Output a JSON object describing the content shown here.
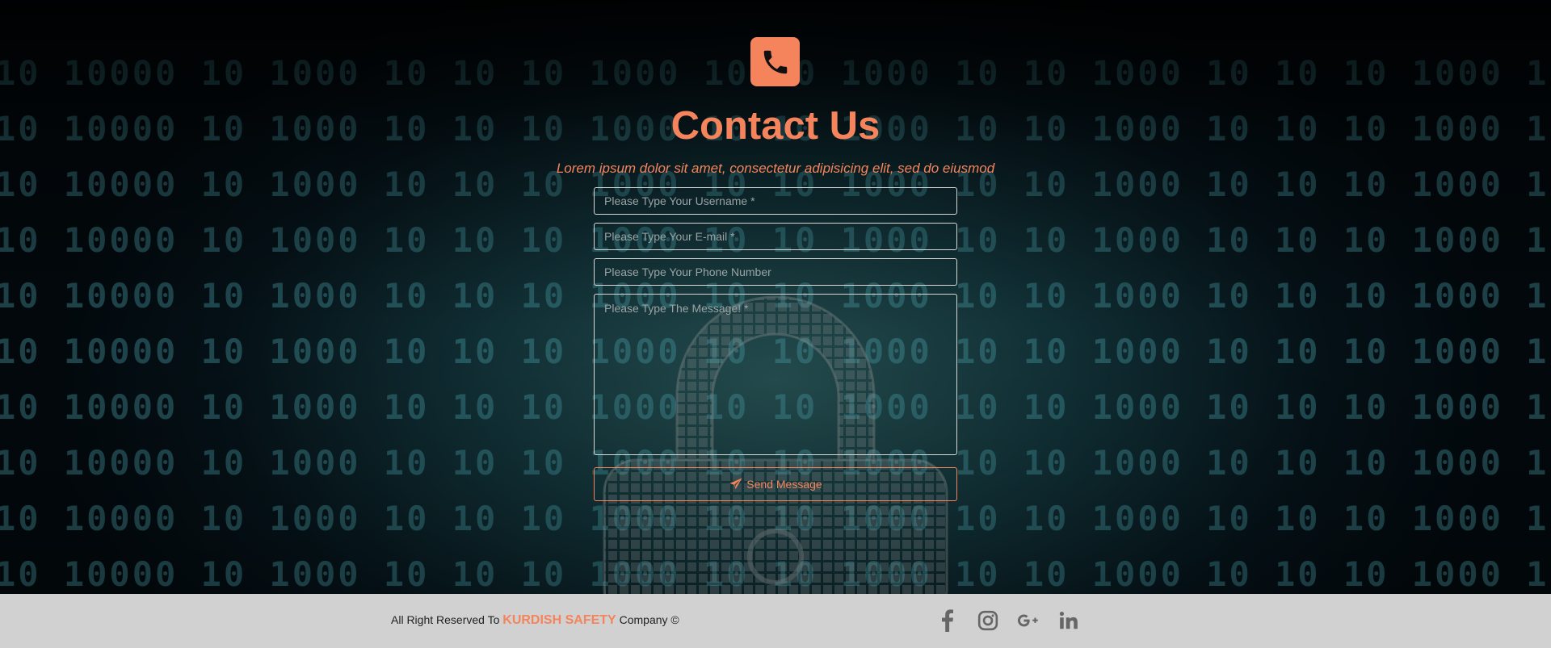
{
  "header": {
    "icon": "phone-icon",
    "title": "Contact Us",
    "subtitle": "Lorem ipsum dolor sit amet, consectetur adipisicing elit, sed do eiusmod"
  },
  "form": {
    "username_placeholder": "Please Type Your Username *",
    "email_placeholder": "Please Type Your E-mail *",
    "phone_placeholder": "Please Type Your Phone Number",
    "message_placeholder": "Please Type The Message! *",
    "send_label": "Send Message",
    "send_icon": "paper-plane-icon"
  },
  "footer": {
    "copy_prefix": "All Right Reserved To",
    "brand": "KURDISH SAFETY",
    "copy_suffix": "Company ©",
    "social": [
      "facebook-icon",
      "instagram-icon",
      "google-plus-icon",
      "linkedin-icon"
    ]
  },
  "colors": {
    "accent": "#f5845c",
    "footer_bg": "#d1d1d1"
  }
}
